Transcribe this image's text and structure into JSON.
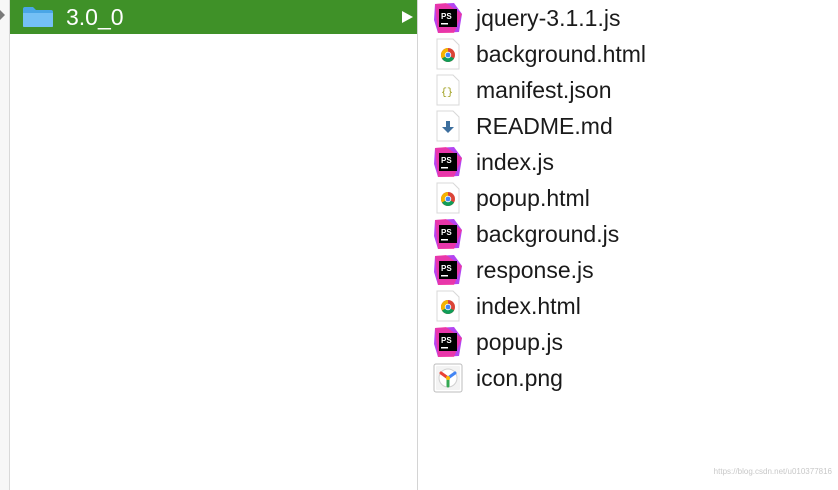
{
  "folder": {
    "name": "3.0_0",
    "icon": "folder-icon",
    "highlight_color": "#3f9128"
  },
  "files": [
    {
      "name": "jquery-3.1.1.js",
      "icon": "phpstorm-icon"
    },
    {
      "name": "background.html",
      "icon": "chrome-doc-icon"
    },
    {
      "name": "manifest.json",
      "icon": "json-doc-icon"
    },
    {
      "name": "README.md",
      "icon": "markdown-doc-icon"
    },
    {
      "name": "index.js",
      "icon": "phpstorm-icon"
    },
    {
      "name": "popup.html",
      "icon": "chrome-doc-icon"
    },
    {
      "name": "background.js",
      "icon": "phpstorm-icon"
    },
    {
      "name": "response.js",
      "icon": "phpstorm-icon"
    },
    {
      "name": "index.html",
      "icon": "chrome-doc-icon"
    },
    {
      "name": "popup.js",
      "icon": "phpstorm-icon"
    },
    {
      "name": "icon.png",
      "icon": "image-file-icon"
    }
  ],
  "watermark": "https://blog.csdn.net/u010377816"
}
